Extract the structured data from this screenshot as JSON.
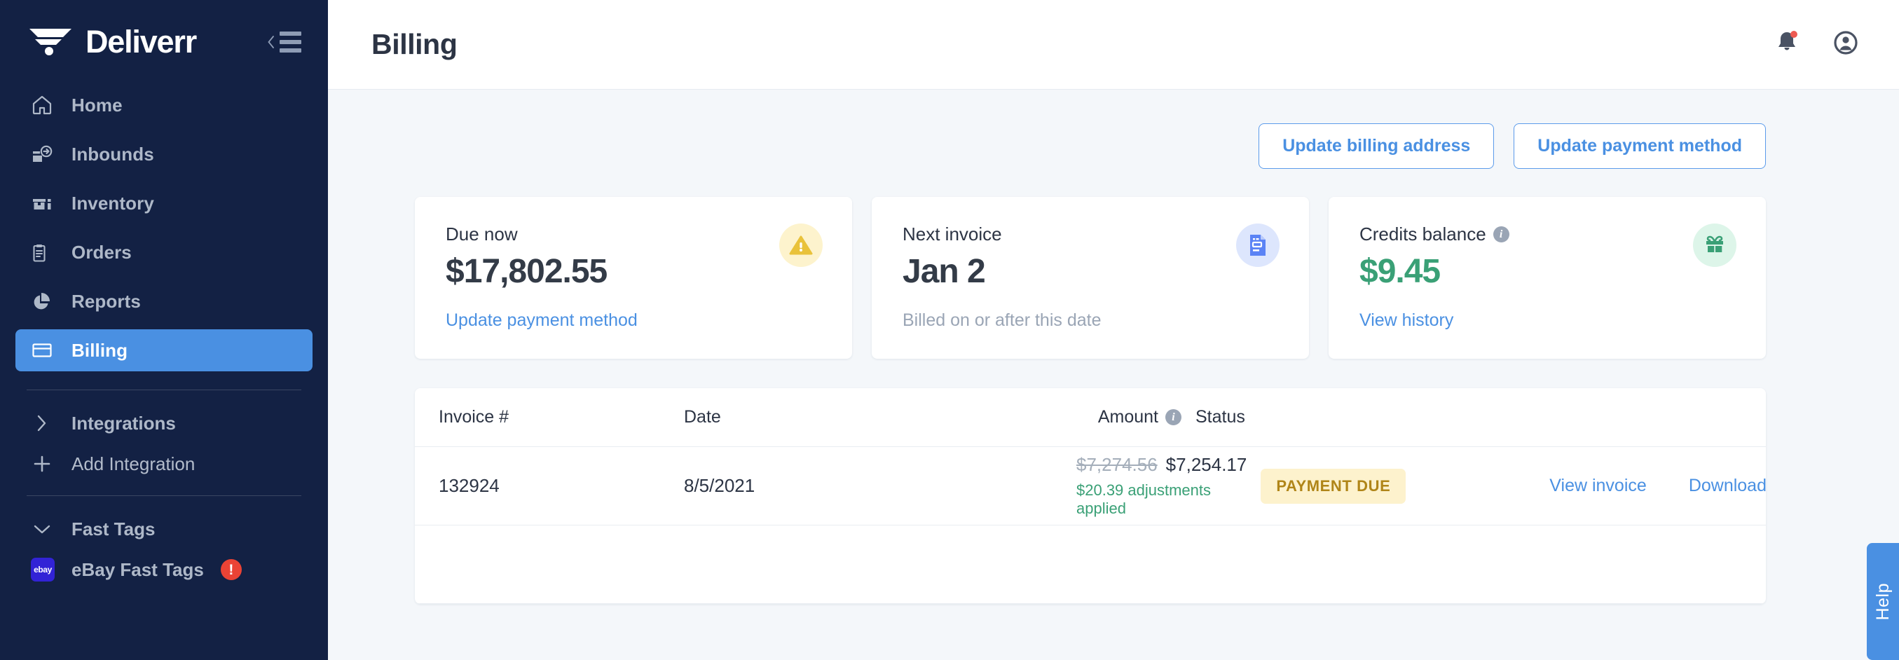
{
  "brand": {
    "name": "Deliverr",
    "logo_icon": "deliverr-logo-icon",
    "collapse_icon": "collapse-sidebar-icon"
  },
  "sidebar": {
    "nav": [
      {
        "label": "Home",
        "icon": "home-icon",
        "active": false
      },
      {
        "label": "Inbounds",
        "icon": "inbound-icon",
        "active": false
      },
      {
        "label": "Inventory",
        "icon": "inventory-icon",
        "active": false
      },
      {
        "label": "Orders",
        "icon": "orders-icon",
        "active": false
      },
      {
        "label": "Reports",
        "icon": "reports-icon",
        "active": false
      },
      {
        "label": "Billing",
        "icon": "billing-icon",
        "active": true
      }
    ],
    "sections": [
      {
        "label": "Integrations",
        "icon": "chevron-right-icon"
      },
      {
        "label": "Add Integration",
        "icon": "plus-icon"
      }
    ],
    "fast_tags": {
      "label": "Fast Tags",
      "icon": "chevron-down-icon"
    },
    "fast_tag_items": [
      {
        "label": "eBay Fast Tags",
        "badge_text": "ebay",
        "alert": "!"
      }
    ]
  },
  "topbar": {
    "title": "Billing",
    "notifications_icon": "bell-icon",
    "account_icon": "account-avatar-icon",
    "has_notification_dot": true
  },
  "actions": {
    "update_billing_address": "Update billing address",
    "update_payment_method": "Update payment method"
  },
  "cards": [
    {
      "label": "Due now",
      "value": "$17,802.55",
      "footer": "Update payment method",
      "footer_kind": "link",
      "icon": "warning-triangle-icon",
      "icon_bg": "#fdf3cd",
      "icon_color": "#e9c23b",
      "value_color": "#333b47",
      "has_info": false
    },
    {
      "label": "Next invoice",
      "value": "Jan 2",
      "footer": "Billed on or after this date",
      "footer_kind": "muted",
      "icon": "invoice-document-icon",
      "icon_bg": "#dde6fd",
      "icon_color": "#5b83f5",
      "value_color": "#333b47",
      "has_info": false
    },
    {
      "label": "Credits balance",
      "value": "$9.45",
      "footer": "View history",
      "footer_kind": "link",
      "icon": "gift-icon",
      "icon_bg": "#ddf5e9",
      "icon_color": "#3aa076",
      "value_color": "#3aa076",
      "has_info": true
    }
  ],
  "table": {
    "columns": {
      "invoice": "Invoice #",
      "date": "Date",
      "amount": "Amount",
      "status": "Status"
    },
    "amount_has_info": true,
    "rows": [
      {
        "invoice": "132924",
        "date": "8/5/2021",
        "amount_original": "$7,274.56",
        "amount_final": "$7,254.17",
        "adjustment": "$20.39 adjustments applied",
        "status": "PAYMENT DUE",
        "view_invoice": "View invoice",
        "download_csv": "Download CSV"
      }
    ]
  },
  "help": {
    "label": "Help"
  },
  "colors": {
    "sidebar_bg": "#132144",
    "accent_blue": "#4a90e2",
    "content_bg": "#f4f7fa",
    "badge_bg": "#fdf2cd",
    "badge_text": "#b08518",
    "green": "#3aa076",
    "alert_red": "#ea4335"
  }
}
